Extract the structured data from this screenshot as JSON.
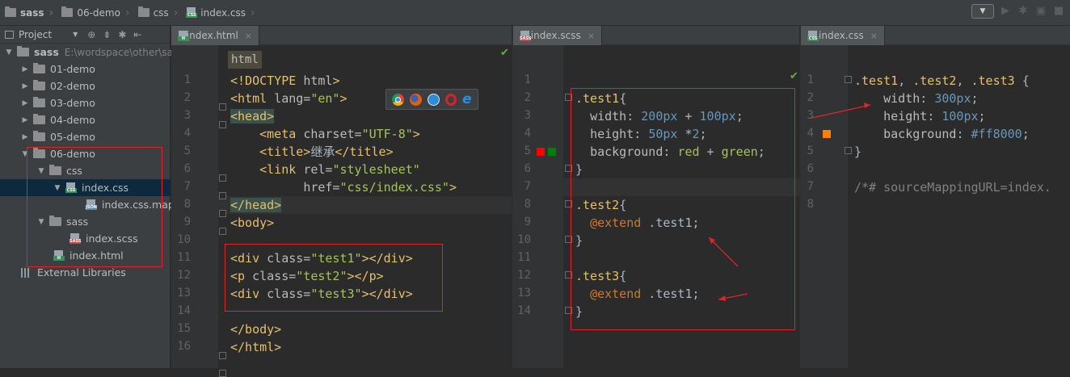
{
  "breadcrumbs": [
    {
      "label": "sass",
      "bold": true
    },
    {
      "label": "06-demo"
    },
    {
      "label": "css"
    },
    {
      "label": "index.css",
      "file": "css"
    }
  ],
  "project_panel": {
    "title": "Project",
    "tree": [
      {
        "label": "sass",
        "path": "E:\\wordspace\\other\\sa",
        "type": "folder",
        "expanded": true,
        "depth": 0
      },
      {
        "label": "01-demo",
        "type": "folder",
        "depth": 1
      },
      {
        "label": "02-demo",
        "type": "folder",
        "depth": 1
      },
      {
        "label": "03-demo",
        "type": "folder",
        "depth": 1
      },
      {
        "label": "04-demo",
        "type": "folder",
        "depth": 1
      },
      {
        "label": "05-demo",
        "type": "folder",
        "depth": 1
      },
      {
        "label": "06-demo",
        "type": "folder",
        "expanded": true,
        "depth": 1
      },
      {
        "label": "css",
        "type": "folder",
        "expanded": true,
        "depth": 2
      },
      {
        "label": "index.css",
        "type": "css",
        "expanded": true,
        "depth": 3,
        "selected": true
      },
      {
        "label": "index.css.map",
        "type": "json",
        "depth": 4
      },
      {
        "label": "sass",
        "type": "folder",
        "expanded": true,
        "depth": 2
      },
      {
        "label": "index.scss",
        "type": "sass",
        "depth": 3
      },
      {
        "label": "index.html",
        "type": "html",
        "depth": 2
      }
    ],
    "external_libraries": "External Libraries"
  },
  "editors": {
    "html": {
      "tab": "index.html",
      "breadcrumb_tag": "html",
      "line_numbers": [
        "1",
        "2",
        "3",
        "4",
        "5",
        "6",
        "7",
        "8",
        "9",
        "10",
        "11",
        "12",
        "13",
        "14",
        "15",
        "16"
      ]
    },
    "scss": {
      "tab": "index.scss",
      "line_numbers": [
        "1",
        "2",
        "3",
        "4",
        "5",
        "6",
        "7",
        "8",
        "9",
        "10",
        "11",
        "12",
        "13",
        "14"
      ]
    },
    "css": {
      "tab": "index.css",
      "line_numbers": [
        "1",
        "2",
        "3",
        "4",
        "5",
        "6",
        "7",
        "8"
      ]
    }
  },
  "colors": {
    "annotation_red": "#e0242a",
    "swatch_red": "#ff0000",
    "swatch_green": "#008000",
    "swatch_orange": "#ff8000"
  },
  "icons": [
    "chrome-icon",
    "firefox-icon",
    "safari-icon",
    "opera-icon",
    "ie-icon"
  ]
}
